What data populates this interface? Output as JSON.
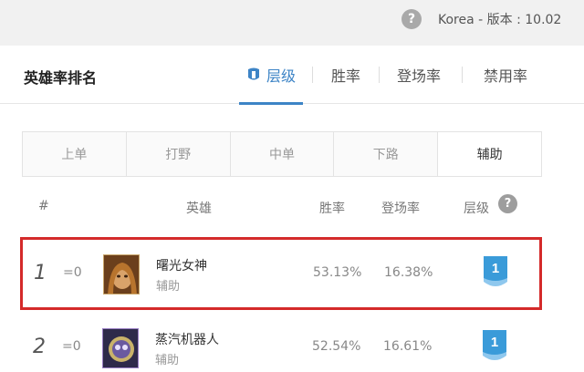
{
  "top": {
    "help_glyph": "?",
    "region_version": "Korea - 版本 : 10.02"
  },
  "panel": {
    "title": "英雄率排名",
    "tabs": [
      {
        "label": "层级",
        "icon": "tier-icon",
        "active": true
      },
      {
        "label": "胜率"
      },
      {
        "label": "登场率"
      },
      {
        "label": "禁用率"
      }
    ]
  },
  "lanes": [
    {
      "label": "上单"
    },
    {
      "label": "打野"
    },
    {
      "label": "中单"
    },
    {
      "label": "下路"
    },
    {
      "label": "辅助",
      "active": true
    }
  ],
  "table": {
    "headers": {
      "rank": "#",
      "hero": "英雄",
      "winrate": "胜率",
      "pickrate": "登场率",
      "tier": "层级",
      "tier_help": "?"
    },
    "rows": [
      {
        "rank": "1",
        "delta": "=0",
        "name": "曙光女神",
        "role": "辅助",
        "winrate": "53.13%",
        "pickrate": "16.38%",
        "tier": "1",
        "highlight": true
      },
      {
        "rank": "2",
        "delta": "=0",
        "name": "蒸汽机器人",
        "role": "辅助",
        "winrate": "52.54%",
        "pickrate": "16.61%",
        "tier": "1"
      }
    ]
  },
  "colors": {
    "accent": "#3d84c6",
    "highlight_border": "#d42a2a",
    "tier_badge": "#3a9bd9"
  }
}
